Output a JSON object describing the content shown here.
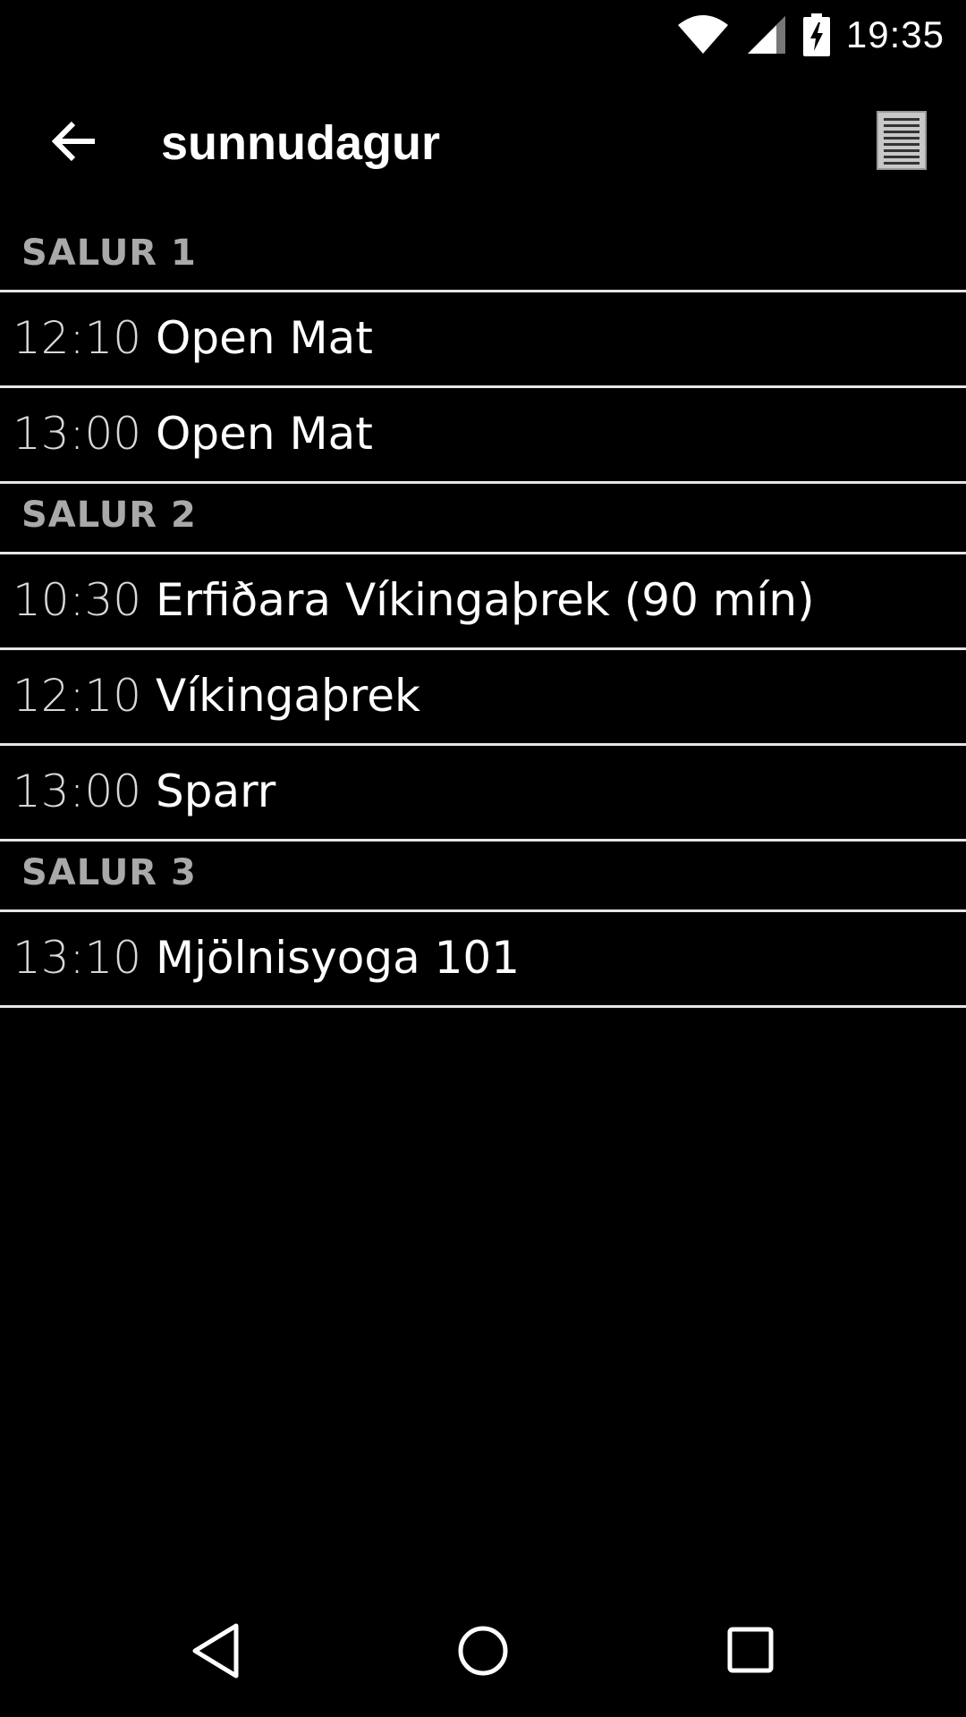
{
  "status_bar": {
    "time": "19:35",
    "icons": [
      "wifi-icon",
      "cell-signal-icon",
      "battery-charging-icon"
    ]
  },
  "app_bar": {
    "title": "sunnudagur",
    "back_icon": "arrow-left-icon",
    "action_icon": "list-view-icon"
  },
  "sections": [
    {
      "header": "SALUR 1",
      "items": [
        {
          "time": "12:10",
          "name": "Open Mat"
        },
        {
          "time": "13:00",
          "name": "Open Mat"
        }
      ]
    },
    {
      "header": "SALUR 2",
      "items": [
        {
          "time": "10:30",
          "name": "Erfiðara Víkingaþrek (90 mín)"
        },
        {
          "time": "12:10",
          "name": "Víkingaþrek"
        },
        {
          "time": "13:00",
          "name": "Sparr"
        }
      ]
    },
    {
      "header": "SALUR 3",
      "items": [
        {
          "time": "13:10",
          "name": "Mjölnisyoga 101"
        }
      ]
    }
  ],
  "nav_bar": {
    "icons": [
      "nav-back-icon",
      "nav-home-icon",
      "nav-recents-icon"
    ]
  },
  "colors": {
    "background": "#000000",
    "divider": "#e6e6e6",
    "section_header": "#a9a9a9",
    "time_text": "#d8d8d8",
    "primary_text": "#ffffff"
  }
}
